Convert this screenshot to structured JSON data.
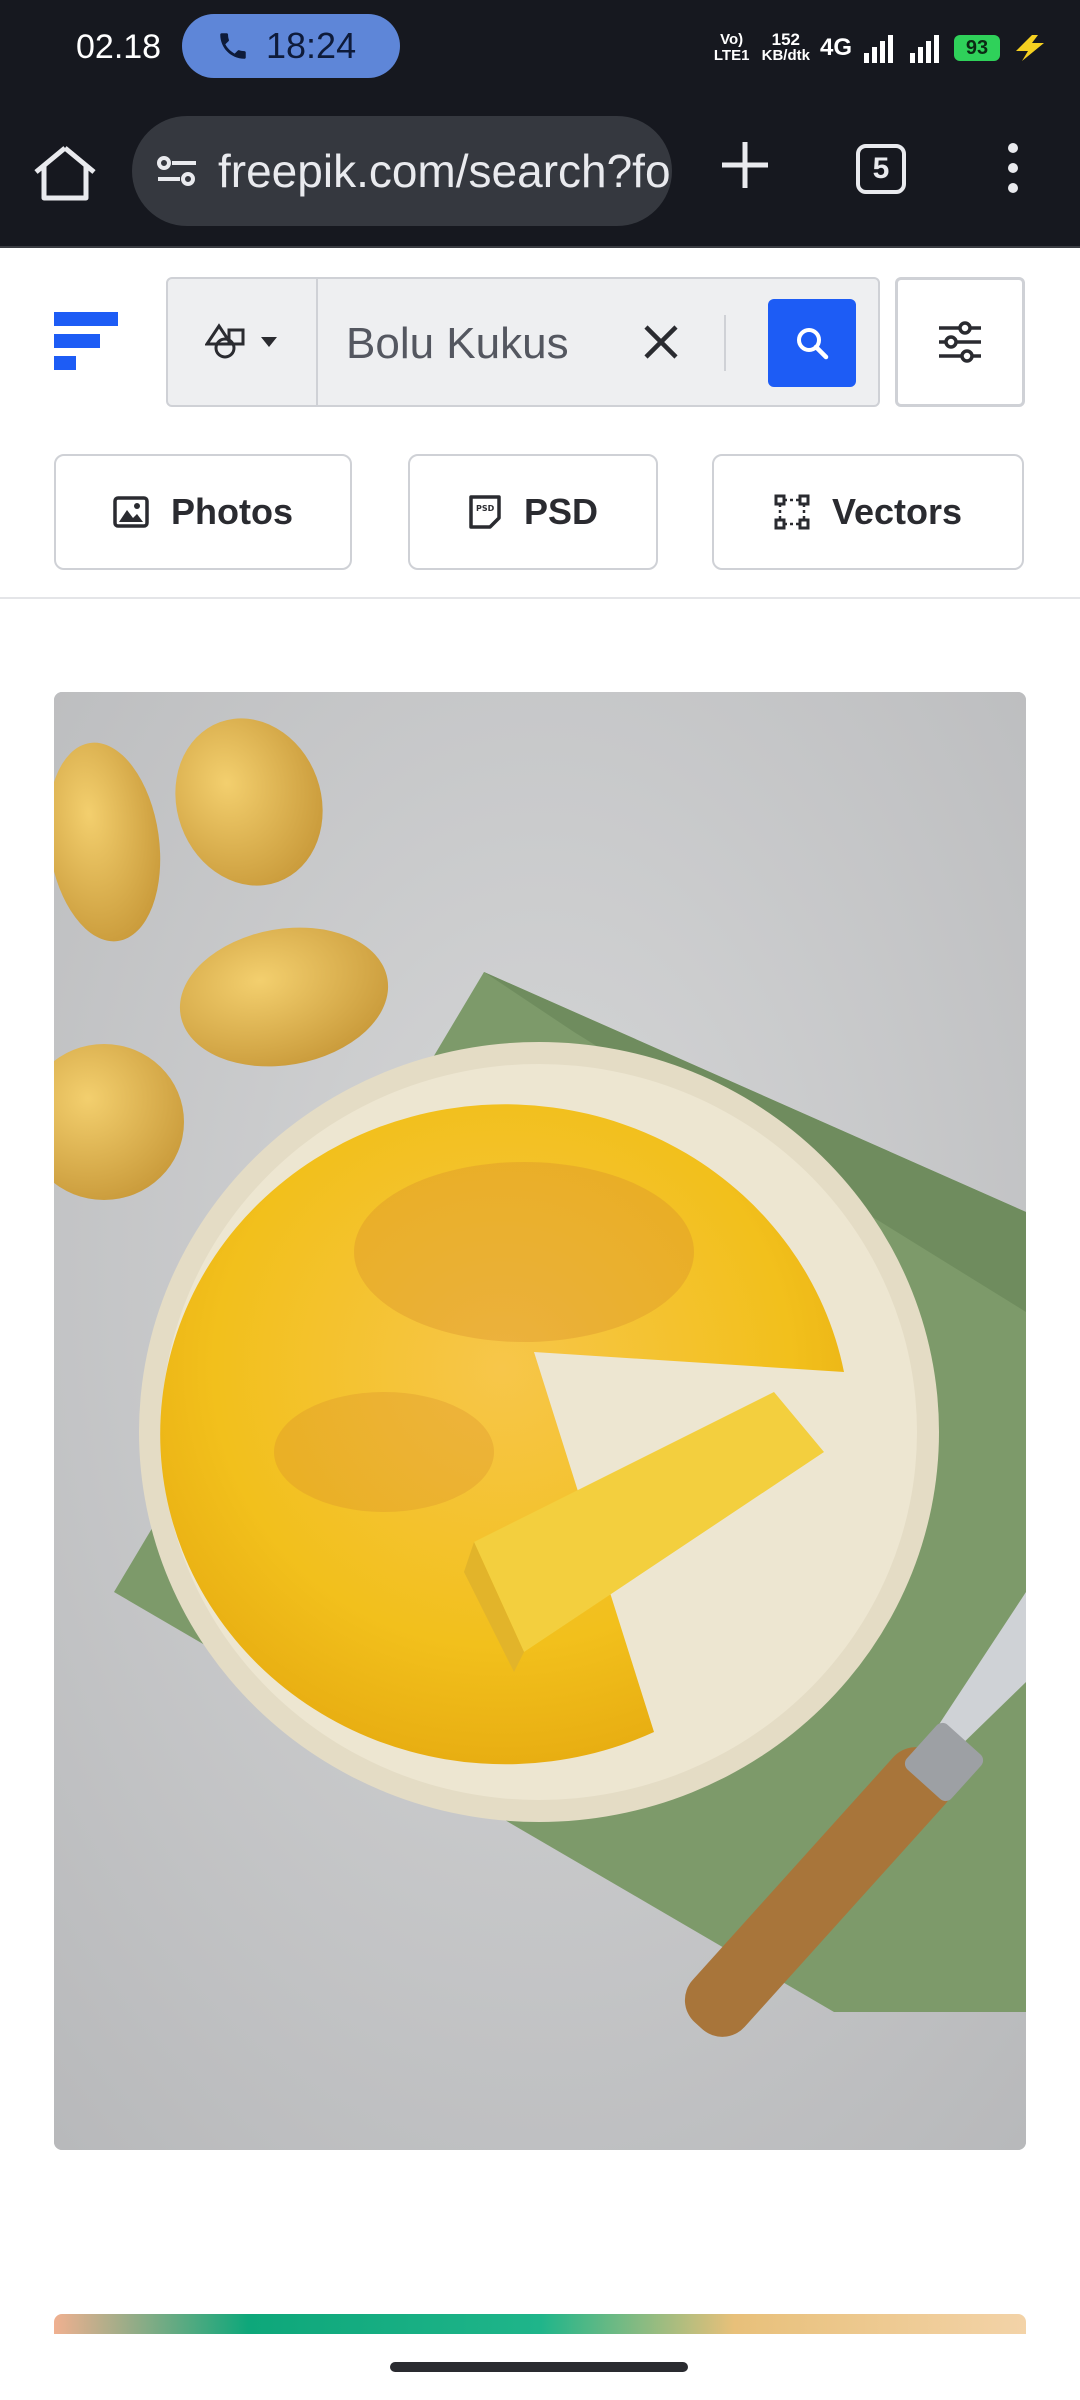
{
  "status_bar": {
    "time": "02.18",
    "call_time": "18:24",
    "volte": "Vo) LTE1",
    "net_speed_value": "152",
    "net_speed_unit": "KB/dtk",
    "network": "4G",
    "battery": "93"
  },
  "browser": {
    "url": "freepik.com/search?fo",
    "tab_count": "5"
  },
  "search": {
    "query": "Bolu Kukus"
  },
  "chips": [
    {
      "label": "Photos",
      "icon": "image-icon"
    },
    {
      "label": "PSD",
      "icon": "psd-file-icon"
    },
    {
      "label": "Vectors",
      "icon": "vector-icon"
    }
  ],
  "results": [
    {
      "image": "spanish-omelette-on-plate-with-potatoes-and-knife"
    }
  ],
  "colors": {
    "brand_blue": "#1d5cf5",
    "dark_bar": "#16181f",
    "battery_green": "#2fd15a",
    "call_pill": "#5e86d8"
  }
}
